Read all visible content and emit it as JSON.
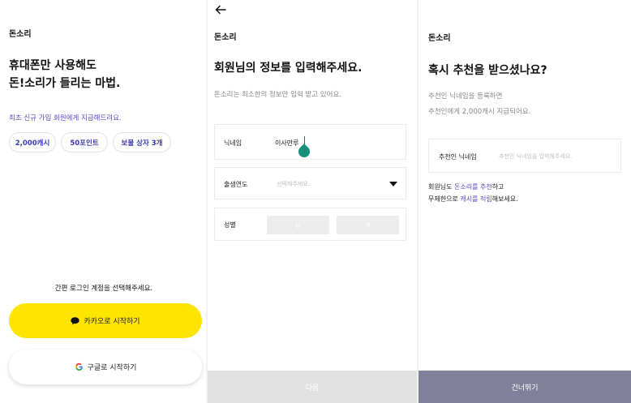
{
  "screen1": {
    "brand": "돈소리",
    "headline_line1": "휴대폰만 사용해도",
    "headline_line2": "돈!소리가 들리는 마법.",
    "subtitle": "최초 신규 가입 회원에게 지급해드려요.",
    "chips": [
      "2,000캐시",
      "50포인트",
      "보물 상자 3개"
    ],
    "login_hint": "간편 로그인 계정을 선택해주세요.",
    "kakao_label": "카카오로 시작하기",
    "google_label": "구글로 시작하기",
    "kakao_color": "#FEE500"
  },
  "screen2": {
    "brand": "돈소리",
    "title": "회원님의 정보를 입력해주세요.",
    "subtitle": "돈소리는 최소한의 정보만 입력 받고 있어요.",
    "nickname_label": "닉네임",
    "nickname_value": "이사만루",
    "birth_label": "출생연도",
    "birth_placeholder": "선택해주세요.",
    "gender_label": "성별",
    "gender_male": "남",
    "gender_female": "여",
    "next_label": "다음"
  },
  "screen3": {
    "brand": "돈소리",
    "title": "혹시 추천을 받으셨나요?",
    "subtitle_line1": "추천인 닉네임을 등록하면",
    "subtitle_line2": "추천인에게 2,000캐시 지급되어요.",
    "referrer_label": "추천인 닉네임",
    "referrer_placeholder": "추천인 닉네임을 입력해주세요.",
    "note_l1_a": "회원님도 ",
    "note_l1_hl": "돈소리를 추천",
    "note_l1_b": "하고",
    "note_l2_a": "무제한으로 ",
    "note_l2_hl": "캐시를 적립",
    "note_l2_b": "해보세요.",
    "skip_label": "건너뛰기",
    "skip_color": "#80809A"
  }
}
